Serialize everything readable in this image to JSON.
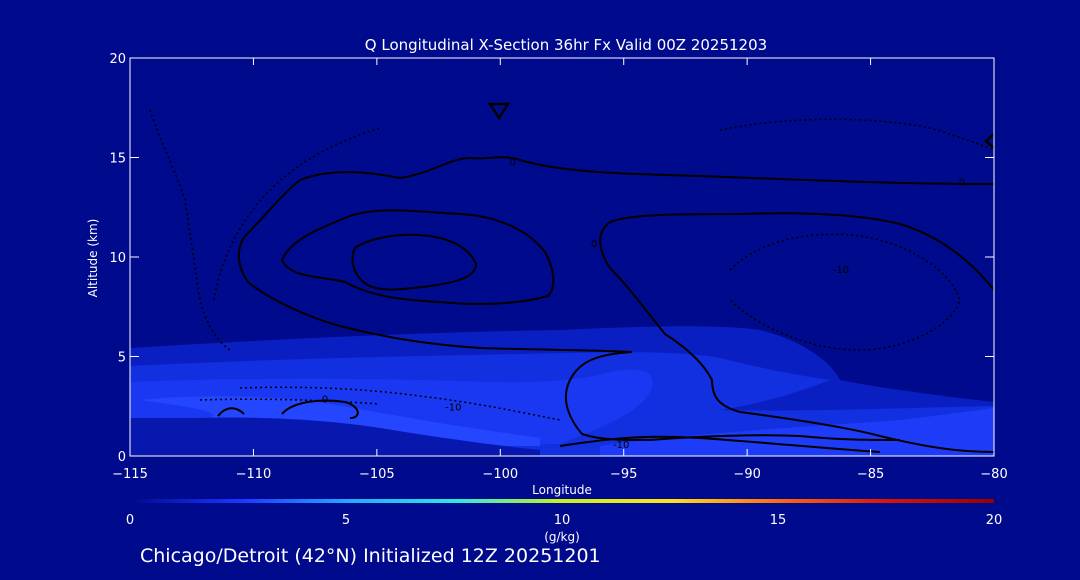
{
  "chart_data": {
    "type": "contour",
    "title": "Q Longitudinal X-Section 36hr  Fx Valid 00Z 20251203",
    "xlabel": "Longitude",
    "ylabel": "Altitude (km)",
    "xlim": [
      -115,
      -80
    ],
    "ylim": [
      0,
      20
    ],
    "x_ticks": [
      -115,
      -110,
      -105,
      -100,
      -95,
      -90,
      -85,
      -80
    ],
    "y_ticks": [
      0,
      5,
      10,
      15,
      20
    ],
    "grid": false,
    "contour_labels": [
      {
        "text": "0",
        "x": -96.2,
        "y": 10.7
      },
      {
        "text": "0",
        "x": -99.5,
        "y": 14.8
      },
      {
        "text": "0",
        "x": -81.3,
        "y": 13.8
      },
      {
        "text": "0",
        "x": -107.1,
        "y": 2.9
      },
      {
        "text": "-10",
        "x": -101.9,
        "y": 2.5
      },
      {
        "text": "-10",
        "x": -95.1,
        "y": 0.6
      },
      {
        "text": "-10",
        "x": -86.2,
        "y": 9.4
      }
    ],
    "colorbar": {
      "min": 0,
      "max": 20,
      "ticks": [
        0,
        5,
        10,
        15,
        20
      ],
      "label": "(g/kg)",
      "colors": [
        "#000a8c",
        "#1c34ff",
        "#27a5ff",
        "#2ee8e0",
        "#c9f21c",
        "#ffe21c",
        "#ff6a10",
        "#d81408",
        "#980000"
      ]
    }
  },
  "footer": "Chicago/Detroit (42°N) Initialized 12Z 20251201"
}
